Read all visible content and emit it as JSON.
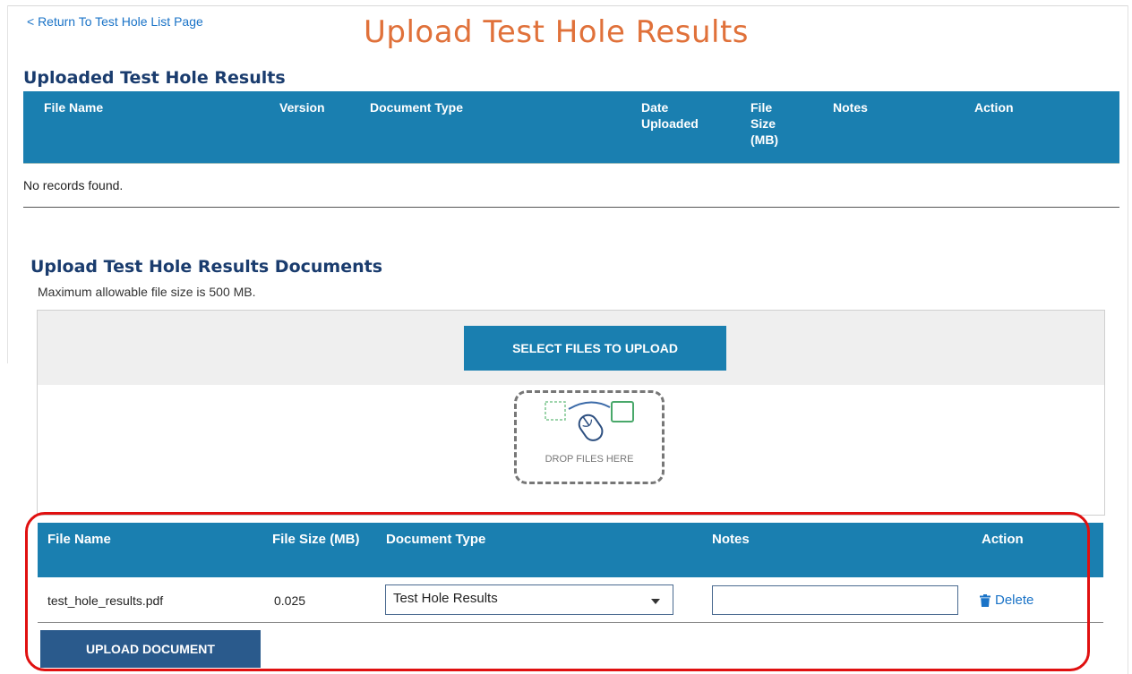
{
  "header": {
    "back_link": "< Return To Test Hole List Page",
    "title": "Upload Test Hole Results"
  },
  "uploaded_section": {
    "title": "Uploaded Test Hole Results",
    "columns": {
      "file_name": "File Name",
      "version": "Version",
      "document_type": "Document Type",
      "date_uploaded_1": "Date",
      "date_uploaded_2": "Uploaded",
      "file_size_1": "File",
      "file_size_2": "Size",
      "file_size_3": "(MB)",
      "notes": "Notes",
      "action": "Action"
    },
    "empty_text": "No records found."
  },
  "upload_section": {
    "title": "Upload Test Hole Results Documents",
    "max_size_text": "Maximum allowable file size is 500 MB.",
    "select_button": "SELECT FILES TO UPLOAD",
    "drop_text": "DROP FILES HERE",
    "columns": {
      "file_name": "File Name",
      "file_size": "File Size (MB)",
      "document_type": "Document Type",
      "notes": "Notes",
      "action": "Action"
    },
    "rows": [
      {
        "file_name": "test_hole_results.pdf",
        "file_size": "0.025",
        "document_type": "Test Hole Results",
        "notes": "",
        "action": "Delete"
      }
    ],
    "upload_button": "UPLOAD DOCUMENT"
  },
  "colors": {
    "accent_title": "#e0713a",
    "header_blue": "#1a7fb0",
    "section_title": "#1a3c6e",
    "link": "#1a73c7",
    "highlight": "#e01010"
  },
  "icons": {
    "delete": "trash-icon",
    "drop": "mouse-drag-icon"
  }
}
